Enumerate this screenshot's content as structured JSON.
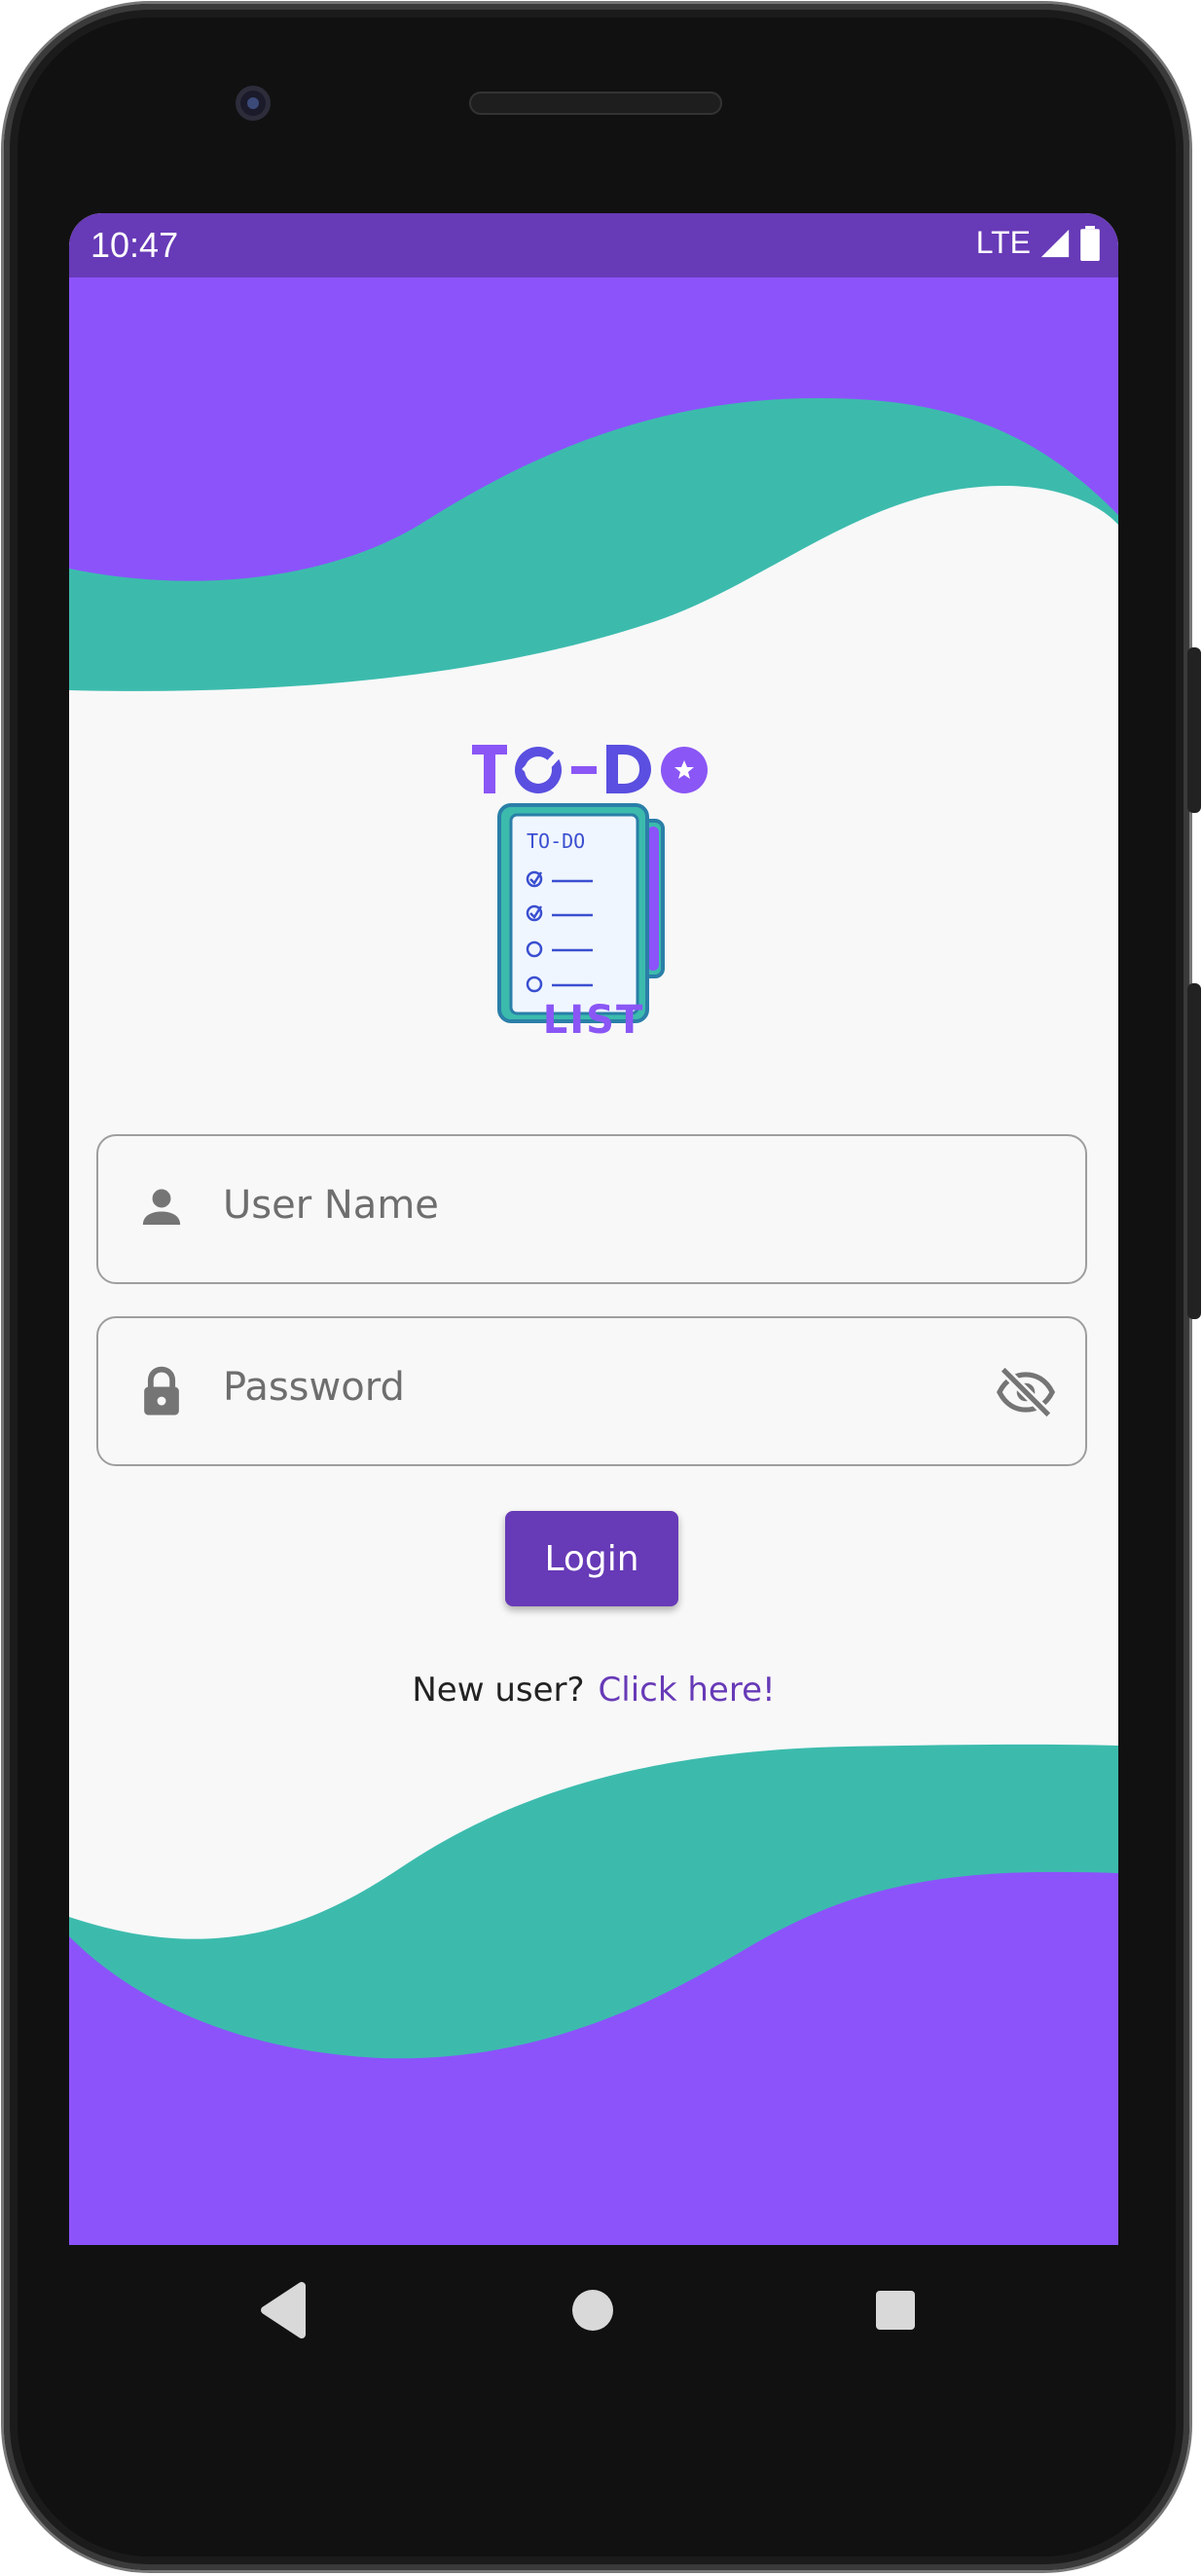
{
  "status_bar": {
    "time": "10:47",
    "network": "LTE"
  },
  "logo": {
    "title": "TO-DO",
    "subtitle": "LIST",
    "notebook_text": "TO-DO"
  },
  "form": {
    "username_placeholder": "User Name",
    "password_placeholder": "Password",
    "login_label": "Login"
  },
  "register": {
    "prompt": "New user?",
    "link": "Click here!"
  },
  "nav": {
    "back": "back-icon",
    "home": "home-icon",
    "recents": "recents-icon"
  },
  "colors": {
    "purple": "#8c53fb",
    "teal": "#3cbbad",
    "accent": "#673ab7",
    "background": "#f8f8f8"
  }
}
